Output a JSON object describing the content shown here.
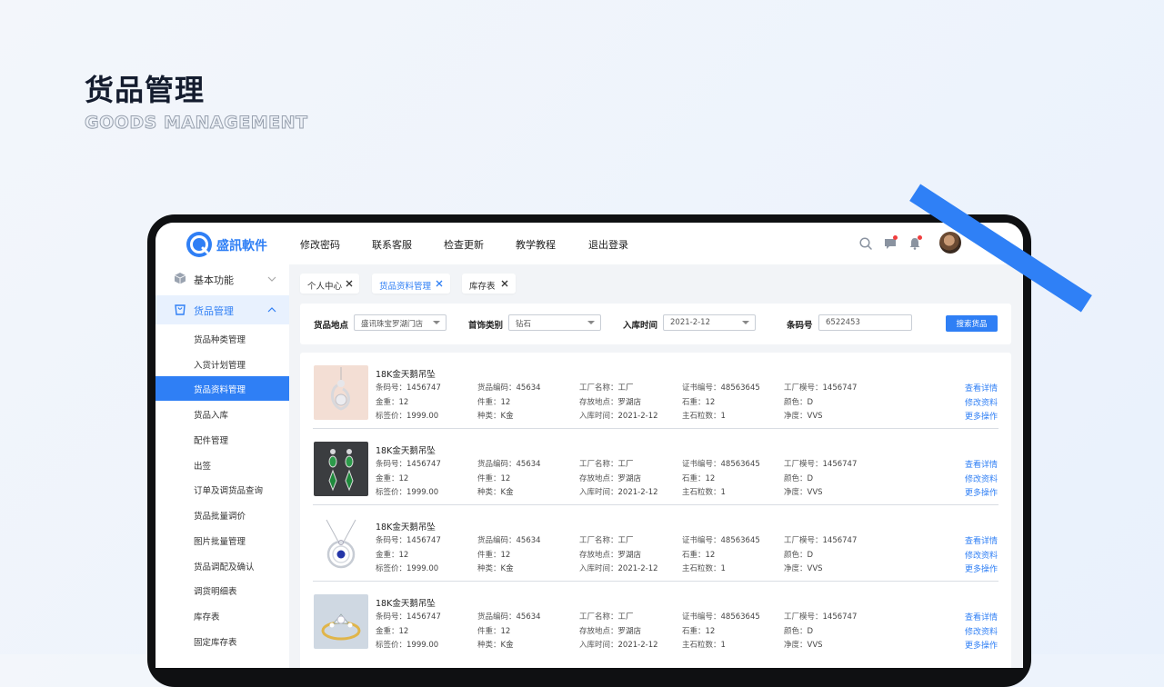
{
  "hero": {
    "title": "货品管理",
    "subtitle": "GOODS MANAGEMENT"
  },
  "topbar": {
    "brand": "盛訊軟件",
    "nav": [
      "修改密码",
      "联系客服",
      "检查更新",
      "教学教程",
      "退出登录"
    ],
    "icons": [
      "search-icon",
      "message-icon",
      "bell-icon",
      "avatar",
      "chevron-down-icon"
    ]
  },
  "sidebar": {
    "groups": [
      {
        "label": "基本功能",
        "icon": "cube-icon",
        "expanded": false
      },
      {
        "label": "货品管理",
        "icon": "bag-icon",
        "expanded": true
      }
    ],
    "items": [
      "货品种类管理",
      "入货计划管理",
      "货品资料管理",
      "货品入库",
      "配件管理",
      "出签",
      "订单及调货品查询",
      "货品批量调价",
      "图片批量管理",
      "货品调配及确认",
      "调货明细表",
      "库存表",
      "固定库存表"
    ],
    "selected_index": 2
  },
  "tabs": [
    {
      "label": "个人中心",
      "active": false
    },
    {
      "label": "货品资料管理",
      "active": true
    },
    {
      "label": "库存表",
      "active": false
    }
  ],
  "filter": {
    "fields": [
      {
        "label": "货品地点",
        "value": "盛讯珠宝罗湖门店",
        "type": "select"
      },
      {
        "label": "首饰类别",
        "value": "钻石",
        "type": "select"
      },
      {
        "label": "入库时间",
        "value": "2021-2-12",
        "type": "select"
      },
      {
        "label": "条码号",
        "value": "6522453",
        "type": "input"
      }
    ],
    "search_button": "搜索货品"
  },
  "products": [
    {
      "title": "18K金天鹅吊坠",
      "image": "swan-pendant",
      "fields": [
        [
          "条码号：",
          "1456747"
        ],
        [
          "金重：",
          "12"
        ],
        [
          "标签价：",
          "1999.00"
        ],
        [
          "货品编码：",
          "45634"
        ],
        [
          "件重：",
          "12"
        ],
        [
          "种类：",
          "K金"
        ],
        [
          "工厂名称：",
          "工厂"
        ],
        [
          "存放地点：",
          "罗湖店"
        ],
        [
          "入库时间：",
          "2021-2-12"
        ],
        [
          "证书编号：",
          "48563645"
        ],
        [
          "石重：",
          "12"
        ],
        [
          "主石粒数：",
          "1"
        ],
        [
          "工厂模号：",
          "1456747"
        ],
        [
          "颜色：",
          "D"
        ],
        [
          "净度：",
          "VVS"
        ]
      ],
      "actions": [
        "查看详情",
        "修改资料",
        "更多操作"
      ]
    },
    {
      "title": "18K金天鹅吊坠",
      "image": "emerald-earrings",
      "fields": [
        [
          "条码号：",
          "1456747"
        ],
        [
          "金重：",
          "12"
        ],
        [
          "标签价：",
          "1999.00"
        ],
        [
          "货品编码：",
          "45634"
        ],
        [
          "件重：",
          "12"
        ],
        [
          "种类：",
          "K金"
        ],
        [
          "工厂名称：",
          "工厂"
        ],
        [
          "存放地点：",
          "罗湖店"
        ],
        [
          "入库时间：",
          "2021-2-12"
        ],
        [
          "证书编号：",
          "48563645"
        ],
        [
          "石重：",
          "12"
        ],
        [
          "主石粒数：",
          "1"
        ],
        [
          "工厂模号：",
          "1456747"
        ],
        [
          "颜色：",
          "D"
        ],
        [
          "净度：",
          "VVS"
        ]
      ],
      "actions": [
        "查看详情",
        "修改资料",
        "更多操作"
      ]
    },
    {
      "title": "18K金天鹅吊坠",
      "image": "sapphire-necklace",
      "fields": [
        [
          "条码号：",
          "1456747"
        ],
        [
          "金重：",
          "12"
        ],
        [
          "标签价：",
          "1999.00"
        ],
        [
          "货品编码：",
          "45634"
        ],
        [
          "件重：",
          "12"
        ],
        [
          "种类：",
          "K金"
        ],
        [
          "工厂名称：",
          "工厂"
        ],
        [
          "存放地点：",
          "罗湖店"
        ],
        [
          "入库时间：",
          "2021-2-12"
        ],
        [
          "证书编号：",
          "48563645"
        ],
        [
          "石重：",
          "12"
        ],
        [
          "主石粒数：",
          "1"
        ],
        [
          "工厂模号：",
          "1456747"
        ],
        [
          "颜色：",
          "D"
        ],
        [
          "净度：",
          "VVS"
        ]
      ],
      "actions": [
        "查看详情",
        "修改资料",
        "更多操作"
      ]
    },
    {
      "title": "18K金天鹅吊坠",
      "image": "diamond-ring",
      "fields": [
        [
          "条码号：",
          "1456747"
        ],
        [
          "金重：",
          "12"
        ],
        [
          "标签价：",
          "1999.00"
        ],
        [
          "货品编码：",
          "45634"
        ],
        [
          "件重：",
          "12"
        ],
        [
          "种类：",
          "K金"
        ],
        [
          "工厂名称：",
          "工厂"
        ],
        [
          "存放地点：",
          "罗湖店"
        ],
        [
          "入库时间：",
          "2021-2-12"
        ],
        [
          "证书编号：",
          "48563645"
        ],
        [
          "石重：",
          "12"
        ],
        [
          "主石粒数：",
          "1"
        ],
        [
          "工厂模号：",
          "1456747"
        ],
        [
          "颜色：",
          "D"
        ],
        [
          "净度：",
          "VVS"
        ]
      ],
      "actions": [
        "查看详情",
        "修改资料",
        "更多操作"
      ]
    }
  ],
  "colors": {
    "accent": "#2f7ff5",
    "stripe": "#2f80f6",
    "badge": "#f03e3e",
    "frame": "#0f1012"
  }
}
